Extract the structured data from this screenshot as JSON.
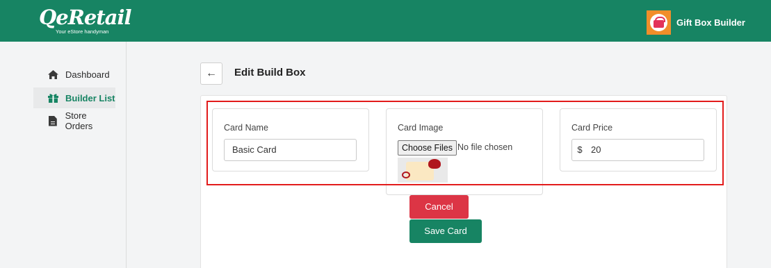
{
  "brand": {
    "logo_text": "QeRetail",
    "tagline": "Your eStore handyman",
    "app_name": "Gift Box Builder",
    "primary_color": "#178463",
    "app_icon_color": "#f18e2a"
  },
  "sidebar": {
    "items": [
      {
        "label": "Dashboard",
        "icon": "home-icon",
        "active": false
      },
      {
        "label": "Builder List",
        "icon": "gift-icon",
        "active": true
      },
      {
        "label": "Store Orders",
        "icon": "document-icon",
        "active": false
      }
    ]
  },
  "page": {
    "back_icon": "arrow-left-icon",
    "title": "Edit Build Box"
  },
  "form": {
    "card_name": {
      "label": "Card Name",
      "value": "Basic Card"
    },
    "card_image": {
      "label": "Card Image",
      "choose_label": "Choose Files",
      "status": "No file chosen"
    },
    "card_price": {
      "label": "Card Price",
      "currency": "$",
      "value": "20"
    }
  },
  "actions": {
    "cancel_label": "Cancel",
    "cancel_color": "#dc3545",
    "save_label": "Save Card",
    "save_color": "#178463"
  },
  "highlight_color": "#e21b1b"
}
